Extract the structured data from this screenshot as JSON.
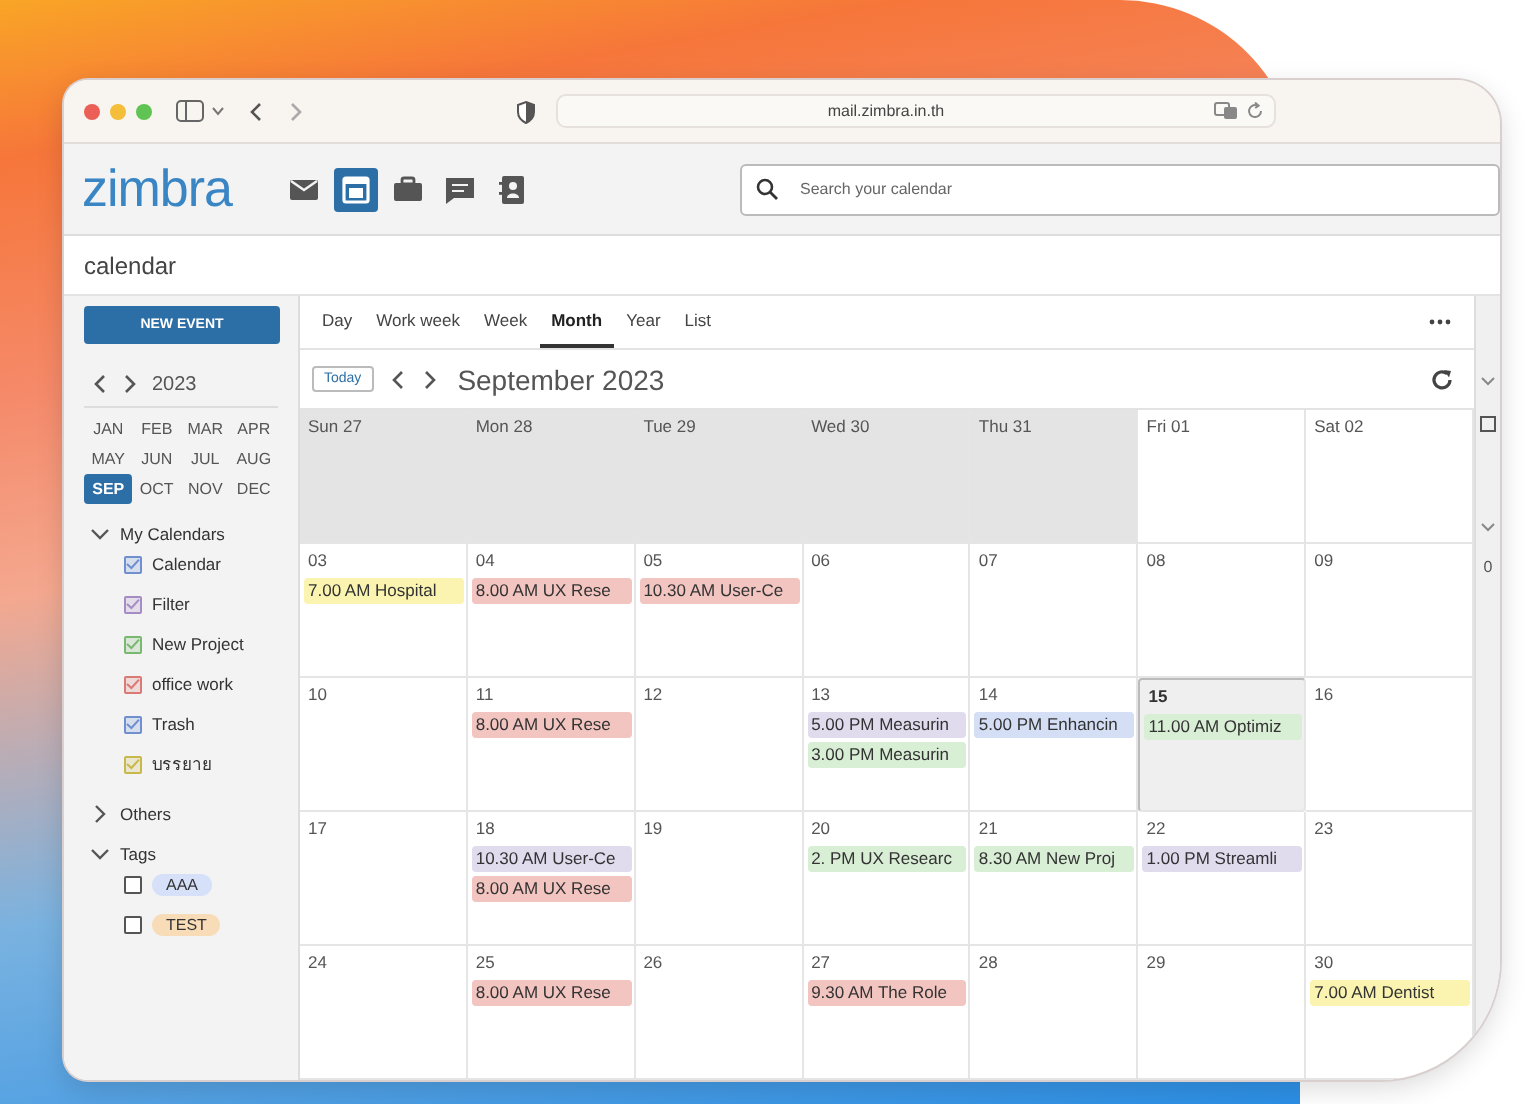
{
  "browser": {
    "url": "mail.zimbra.in.th"
  },
  "app": {
    "logo": "zimbra",
    "nav": [
      {
        "kind": "mail",
        "selected": false
      },
      {
        "kind": "calendar",
        "selected": true
      },
      {
        "kind": "briefcase",
        "selected": false
      },
      {
        "kind": "chat",
        "selected": false
      },
      {
        "kind": "contacts",
        "selected": false
      }
    ],
    "search": {
      "placeholder": "Search your calendar"
    }
  },
  "breadcrumb": "calendar",
  "sidebar": {
    "new_event": "NEW EVENT",
    "year": "2023",
    "months": [
      {
        "label": "JAN",
        "selected": false
      },
      {
        "label": "FEB",
        "selected": false
      },
      {
        "label": "MAR",
        "selected": false
      },
      {
        "label": "APR",
        "selected": false
      },
      {
        "label": "MAY",
        "selected": false
      },
      {
        "label": "JUN",
        "selected": false
      },
      {
        "label": "JUL",
        "selected": false
      },
      {
        "label": "AUG",
        "selected": false
      },
      {
        "label": "SEP",
        "selected": true
      },
      {
        "label": "OCT",
        "selected": false
      },
      {
        "label": "NOV",
        "selected": false
      },
      {
        "label": "DEC",
        "selected": false
      }
    ],
    "sections": [
      {
        "label": "My Calendars",
        "expanded": true,
        "kind": "calendars",
        "items": [
          {
            "label": "Calendar",
            "checked": true,
            "color": "#6f8fd0"
          },
          {
            "label": "Filter",
            "checked": true,
            "color": "#a68cc4"
          },
          {
            "label": "New Project",
            "checked": true,
            "color": "#78b870"
          },
          {
            "label": "office work",
            "checked": true,
            "color": "#d97a74"
          },
          {
            "label": "Trash",
            "checked": true,
            "color": "#6f8fd0"
          },
          {
            "label": "บรรยาย",
            "checked": true,
            "color": "#c8b84a"
          }
        ]
      },
      {
        "label": "Others",
        "expanded": false
      },
      {
        "label": "Tags",
        "expanded": true,
        "kind": "tags",
        "items": [
          {
            "label": "AAA",
            "checked": false,
            "color": "#d6e0f8"
          },
          {
            "label": "TEST",
            "checked": false,
            "color": "#f8dcb8"
          }
        ]
      }
    ]
  },
  "views": [
    {
      "label": "Day",
      "selected": false
    },
    {
      "label": "Work week",
      "selected": false
    },
    {
      "label": "Week",
      "selected": false
    },
    {
      "label": "Month",
      "selected": true
    },
    {
      "label": "Year",
      "selected": false
    },
    {
      "label": "List",
      "selected": false
    }
  ],
  "toolbar": {
    "today": "Today",
    "title": "September 2023"
  },
  "weeks": [
    [
      {
        "label": "Sun 27",
        "shaded": true,
        "today": false
      },
      {
        "label": "Mon 28",
        "shaded": true,
        "today": false
      },
      {
        "label": "Tue 29",
        "shaded": true,
        "today": false
      },
      {
        "label": "Wed 30",
        "shaded": true,
        "today": false
      },
      {
        "label": "Thu 31",
        "shaded": true,
        "today": false
      },
      {
        "label": "Fri 01",
        "shaded": false,
        "today": false
      },
      {
        "label": "Sat 02",
        "shaded": false,
        "today": false
      }
    ],
    [
      {
        "label": "03",
        "shaded": false,
        "today": false,
        "events": [
          {
            "text": "7.00 AM Hospital",
            "color": "#faf4b0"
          }
        ]
      },
      {
        "label": "04",
        "shaded": false,
        "today": false,
        "events": [
          {
            "text": "8.00 AM UX Rese",
            "color": "#f3c5c1"
          }
        ]
      },
      {
        "label": "05",
        "shaded": false,
        "today": false,
        "events": [
          {
            "text": "10.30 AM User-Ce",
            "color": "#f3c5c1"
          }
        ]
      },
      {
        "label": "06",
        "shaded": false,
        "today": false
      },
      {
        "label": "07",
        "shaded": false,
        "today": false
      },
      {
        "label": "08",
        "shaded": false,
        "today": false
      },
      {
        "label": "09",
        "shaded": false,
        "today": false
      }
    ],
    [
      {
        "label": "10",
        "shaded": false,
        "today": false
      },
      {
        "label": "11",
        "shaded": false,
        "today": false,
        "events": [
          {
            "text": "8.00 AM UX Rese",
            "color": "#f3c5c1"
          }
        ]
      },
      {
        "label": "12",
        "shaded": false,
        "today": false
      },
      {
        "label": "13",
        "shaded": false,
        "today": false,
        "events": [
          {
            "text": "5.00 PM Measurin",
            "color": "#e1dbee"
          },
          {
            "text": "3.00 PM Measurin",
            "color": "#d8eed5"
          }
        ]
      },
      {
        "label": "14",
        "shaded": false,
        "today": false,
        "events": [
          {
            "text": "5.00 PM Enhancin",
            "color": "#d4def5"
          }
        ]
      },
      {
        "label": "15",
        "shaded": false,
        "today": true,
        "events": [
          {
            "text": "11.00 AM Optimiz",
            "color": "#d8eed5"
          }
        ]
      },
      {
        "label": "16",
        "shaded": false,
        "today": false
      }
    ],
    [
      {
        "label": "17",
        "shaded": false,
        "today": false
      },
      {
        "label": "18",
        "shaded": false,
        "today": false,
        "events": [
          {
            "text": "10.30 AM User-Ce",
            "color": "#e1dbee"
          },
          {
            "text": "8.00 AM UX Rese",
            "color": "#f3c5c1"
          }
        ]
      },
      {
        "label": "19",
        "shaded": false,
        "today": false
      },
      {
        "label": "20",
        "shaded": false,
        "today": false,
        "events": [
          {
            "text": "2. PM UX Researc",
            "color": "#d8eed5"
          }
        ]
      },
      {
        "label": "21",
        "shaded": false,
        "today": false,
        "events": [
          {
            "text": "8.30 AM New Proj",
            "color": "#d8eed5"
          }
        ]
      },
      {
        "label": "22",
        "shaded": false,
        "today": false,
        "events": [
          {
            "text": "1.00 PM Streamli",
            "color": "#e1dbee"
          }
        ]
      },
      {
        "label": "23",
        "shaded": false,
        "today": false
      }
    ],
    [
      {
        "label": "24",
        "shaded": false,
        "today": false
      },
      {
        "label": "25",
        "shaded": false,
        "today": false,
        "events": [
          {
            "text": "8.00 AM UX Rese",
            "color": "#f3c5c1"
          }
        ]
      },
      {
        "label": "26",
        "shaded": false,
        "today": false
      },
      {
        "label": "27",
        "shaded": false,
        "today": false,
        "events": [
          {
            "text": "9.30 AM The Role",
            "color": "#f3c5c1"
          }
        ]
      },
      {
        "label": "28",
        "shaded": false,
        "today": false
      },
      {
        "label": "29",
        "shaded": false,
        "today": false
      },
      {
        "label": "30",
        "shaded": false,
        "today": false,
        "events": [
          {
            "text": "7.00 AM Dentist",
            "color": "#faf4b0"
          }
        ]
      }
    ]
  ],
  "side_panel": {
    "text": "0"
  }
}
